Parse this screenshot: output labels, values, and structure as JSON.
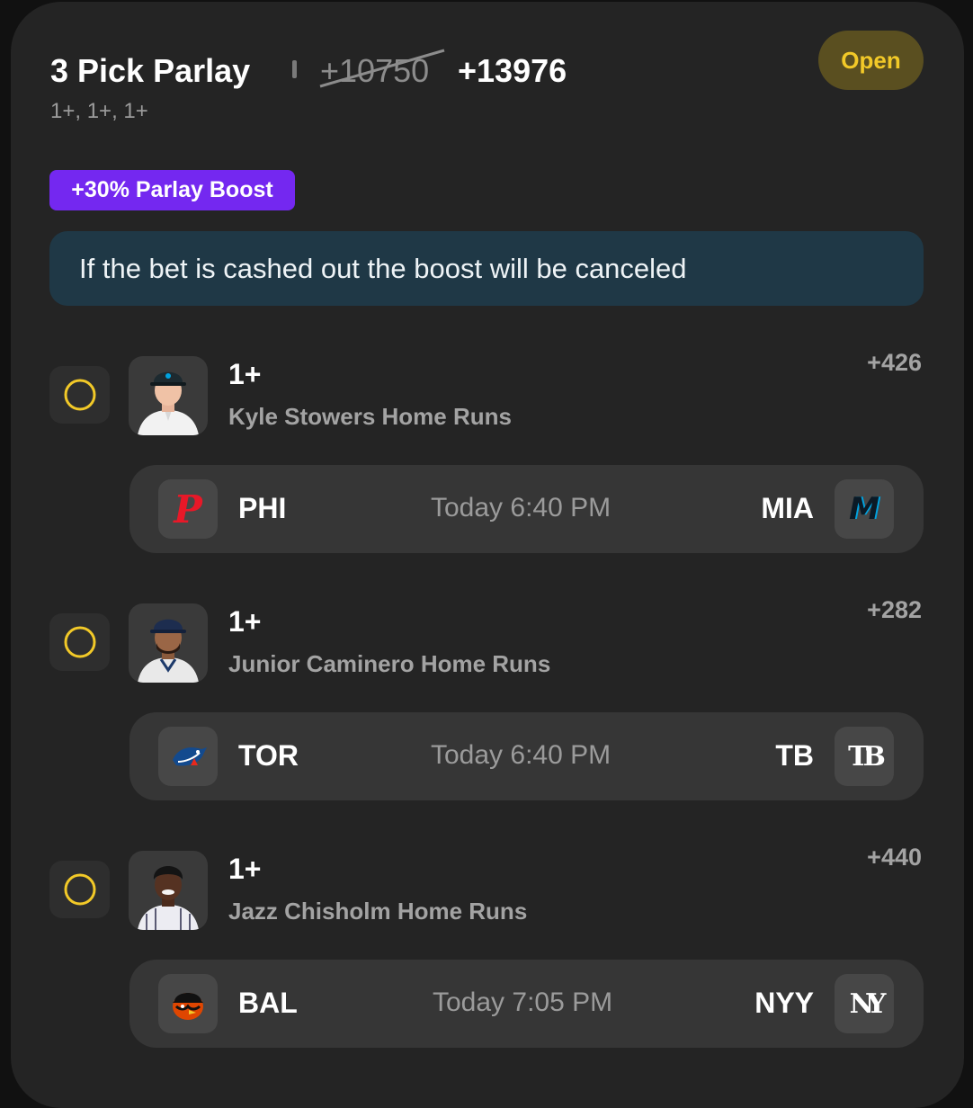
{
  "header": {
    "title": "3 Pick Parlay",
    "old_odds": "+10750",
    "new_odds": "+13976",
    "subtitle": "1+, 1+, 1+",
    "status": "Open"
  },
  "boost": {
    "label": "+30% Parlay Boost",
    "notice": "If the bet is cashed out the boost will be canceled"
  },
  "picks": [
    {
      "line": "1+",
      "market": "Kyle Stowers Home Runs",
      "odds": "+426",
      "game": {
        "away": "PHI",
        "home": "MIA",
        "time": "Today 6:40 PM",
        "away_icon": "phillies-logo-icon",
        "home_icon": "marlins-logo-icon"
      }
    },
    {
      "line": "1+",
      "market": "Junior Caminero Home Runs",
      "odds": "+282",
      "game": {
        "away": "TOR",
        "home": "TB",
        "time": "Today 6:40 PM",
        "away_icon": "blue-jays-logo-icon",
        "home_icon": "rays-logo-icon"
      }
    },
    {
      "line": "1+",
      "market": "Jazz Chisholm Home Runs",
      "odds": "+440",
      "game": {
        "away": "BAL",
        "home": "NYY",
        "time": "Today 7:05 PM",
        "away_icon": "orioles-logo-icon",
        "home_icon": "yankees-logo-icon"
      }
    }
  ],
  "logos": {
    "phi": "P",
    "mia": "M",
    "tb": "TB",
    "nyy": "NY"
  },
  "colors": {
    "status_yellow": "#f2c928",
    "boost_purple": "#7428f0",
    "notice_bg": "#1f3846",
    "phillies_red": "#e81828",
    "marlins_teal": "#00a3e0",
    "blue_jays_blue": "#134a8e",
    "orioles_orange": "#df4601"
  }
}
